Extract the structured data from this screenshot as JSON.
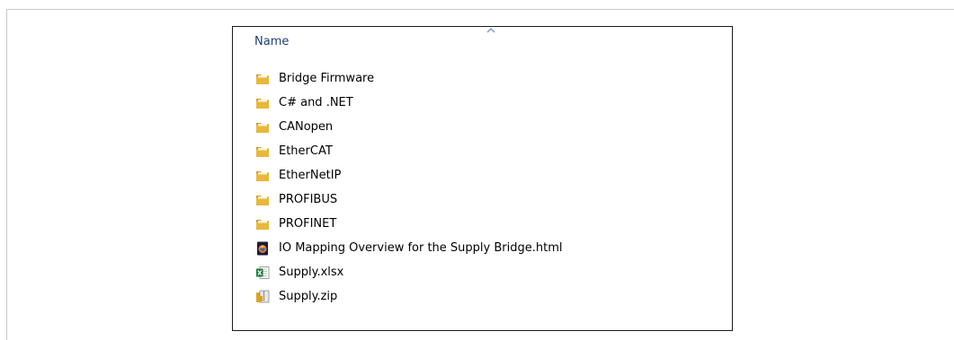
{
  "columns": {
    "name_header": "Name"
  },
  "colors": {
    "folder": "#e8b83a",
    "header_text": "#1e3e74",
    "excel_green": "#1d7a3a",
    "zip_gold": "#d9a521"
  },
  "files": [
    {
      "name": "Bridge Firmware",
      "type": "folder",
      "icon": "folder-icon"
    },
    {
      "name": "C# and .NET",
      "type": "folder",
      "icon": "folder-icon"
    },
    {
      "name": "CANopen",
      "type": "folder",
      "icon": "folder-icon"
    },
    {
      "name": "EtherCAT",
      "type": "folder",
      "icon": "folder-icon"
    },
    {
      "name": "EtherNetIP",
      "type": "folder",
      "icon": "folder-icon"
    },
    {
      "name": "PROFIBUS",
      "type": "folder",
      "icon": "folder-icon"
    },
    {
      "name": "PROFINET",
      "type": "folder",
      "icon": "folder-icon"
    },
    {
      "name": "IO Mapping Overview for the Supply Bridge.html",
      "type": "html",
      "icon": "firefox-html-icon"
    },
    {
      "name": "Supply.xlsx",
      "type": "xlsx",
      "icon": "excel-icon"
    },
    {
      "name": "Supply.zip",
      "type": "zip",
      "icon": "zip-archive-icon"
    }
  ]
}
